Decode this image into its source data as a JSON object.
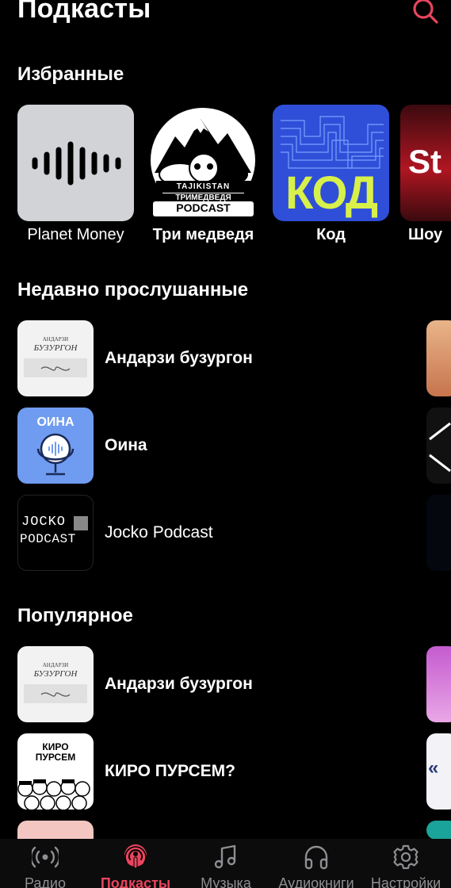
{
  "header": {
    "title": "Подкасты"
  },
  "sections": {
    "favorites": "Избранные",
    "recent": "Недавно прослушанные",
    "popular": "Популярное"
  },
  "favorites": [
    {
      "label": "Planet Money",
      "icon": "waveform"
    },
    {
      "label": "Три медведя",
      "art_text": [
        "TAJIKISTAN",
        "ТРИМЕДВЕДЯ",
        "PODCAST"
      ]
    },
    {
      "label": "Код",
      "art_text": "КОД"
    },
    {
      "label": "Шоу",
      "art_text": "St"
    }
  ],
  "recent": [
    {
      "label": "Андарзи бузургон",
      "art_text": [
        "АНДАРЗИ",
        "БУЗУРГОН"
      ]
    },
    {
      "label": "Оина",
      "art_text": "ОИНА"
    },
    {
      "label": "Jocko Podcast",
      "art_text": [
        "JOCKO",
        "PODCAST"
      ]
    }
  ],
  "popular": [
    {
      "label": "Андарзи бузургон",
      "art_text": [
        "АНДАРЗИ",
        "БУЗУРГОН"
      ]
    },
    {
      "label": "КИРО ПУРСЕМ?",
      "art_text": [
        "КИРО",
        "ПУРСЕМ"
      ]
    }
  ],
  "tabs": [
    {
      "label": "Радио",
      "icon": "radio-icon",
      "active": false
    },
    {
      "label": "Подкасты",
      "icon": "podcast-icon",
      "active": true
    },
    {
      "label": "Музыка",
      "icon": "music-icon",
      "active": false
    },
    {
      "label": "Аудиокниги",
      "icon": "headphones-icon",
      "active": false
    },
    {
      "label": "Настройки",
      "icon": "gear-icon",
      "active": false
    }
  ],
  "colors": {
    "accent": "#e8455e",
    "inactive": "#8e8e93",
    "background": "#000000"
  }
}
